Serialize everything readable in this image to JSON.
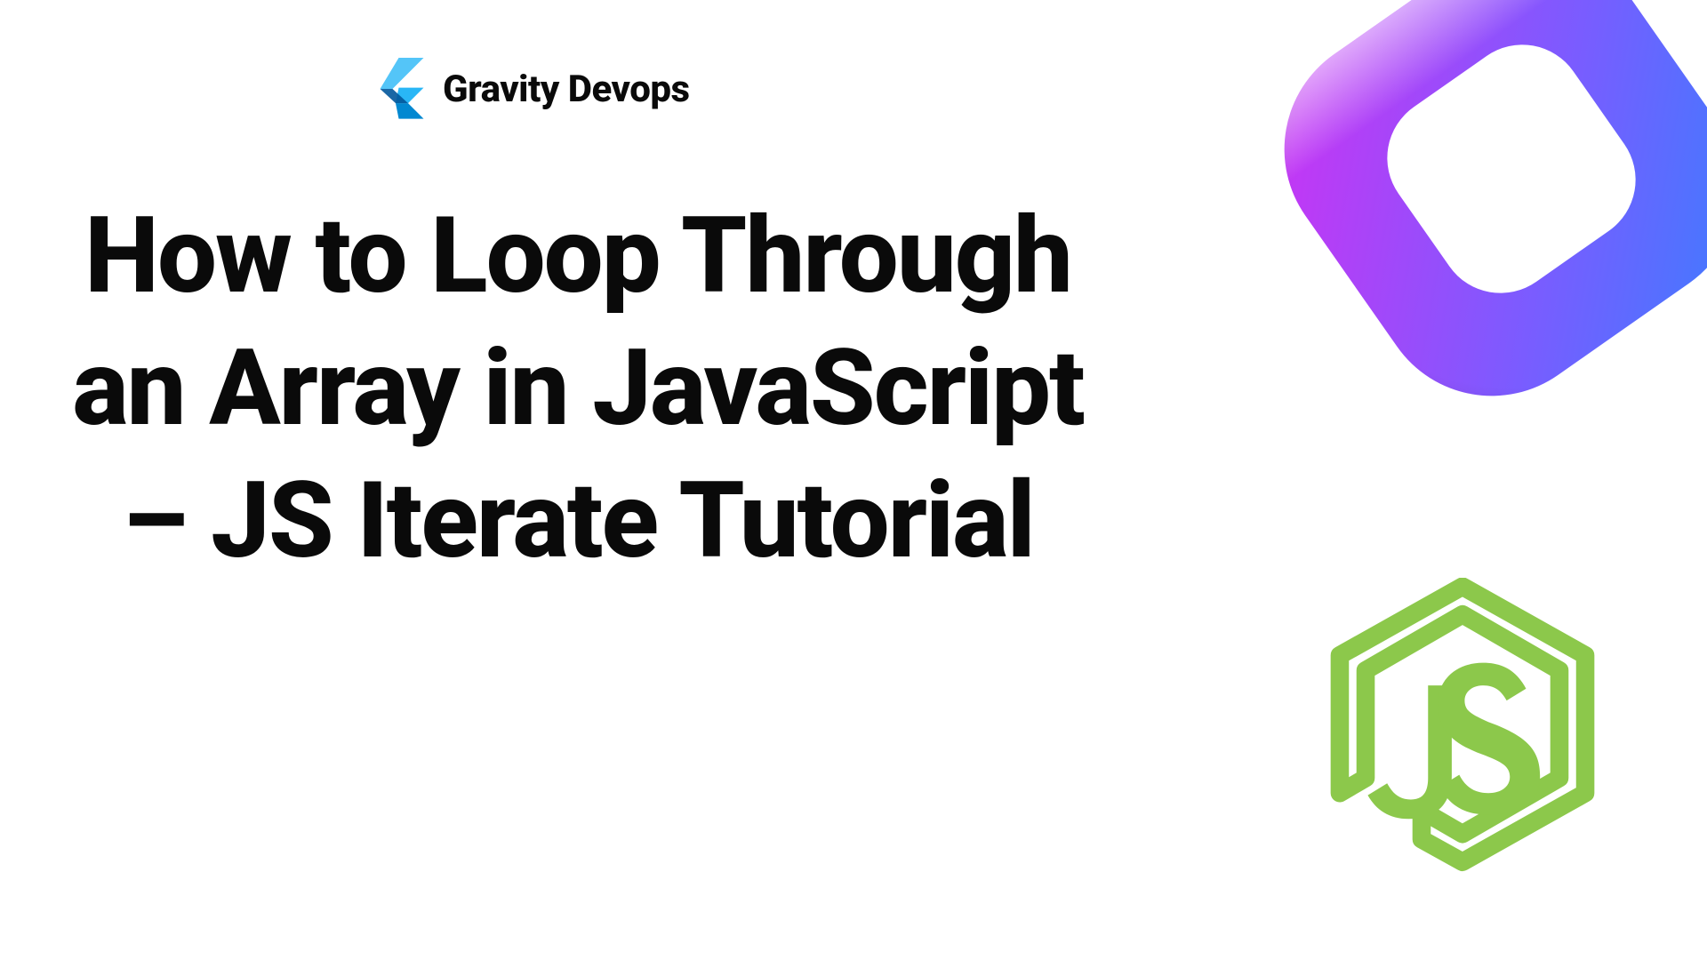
{
  "brand": {
    "name": "Gravity Devops"
  },
  "headline": "How to Loop Through an Array in JavaScript – JS Iterate Tutorial",
  "icons": {
    "chevron": "chevron-logo-icon",
    "ring3d": "ring3d-decorative-icon",
    "js": "nodejs-icon"
  },
  "colors": {
    "text": "#0a0a0a",
    "magenta": "#d03bf0",
    "blue": "#2f6df6",
    "green": "#8cc84b",
    "logo_light": "#54c5f8",
    "logo_mid": "#29b6f6",
    "logo_dark": "#01579b",
    "logo_mid2": "#0288d1"
  }
}
